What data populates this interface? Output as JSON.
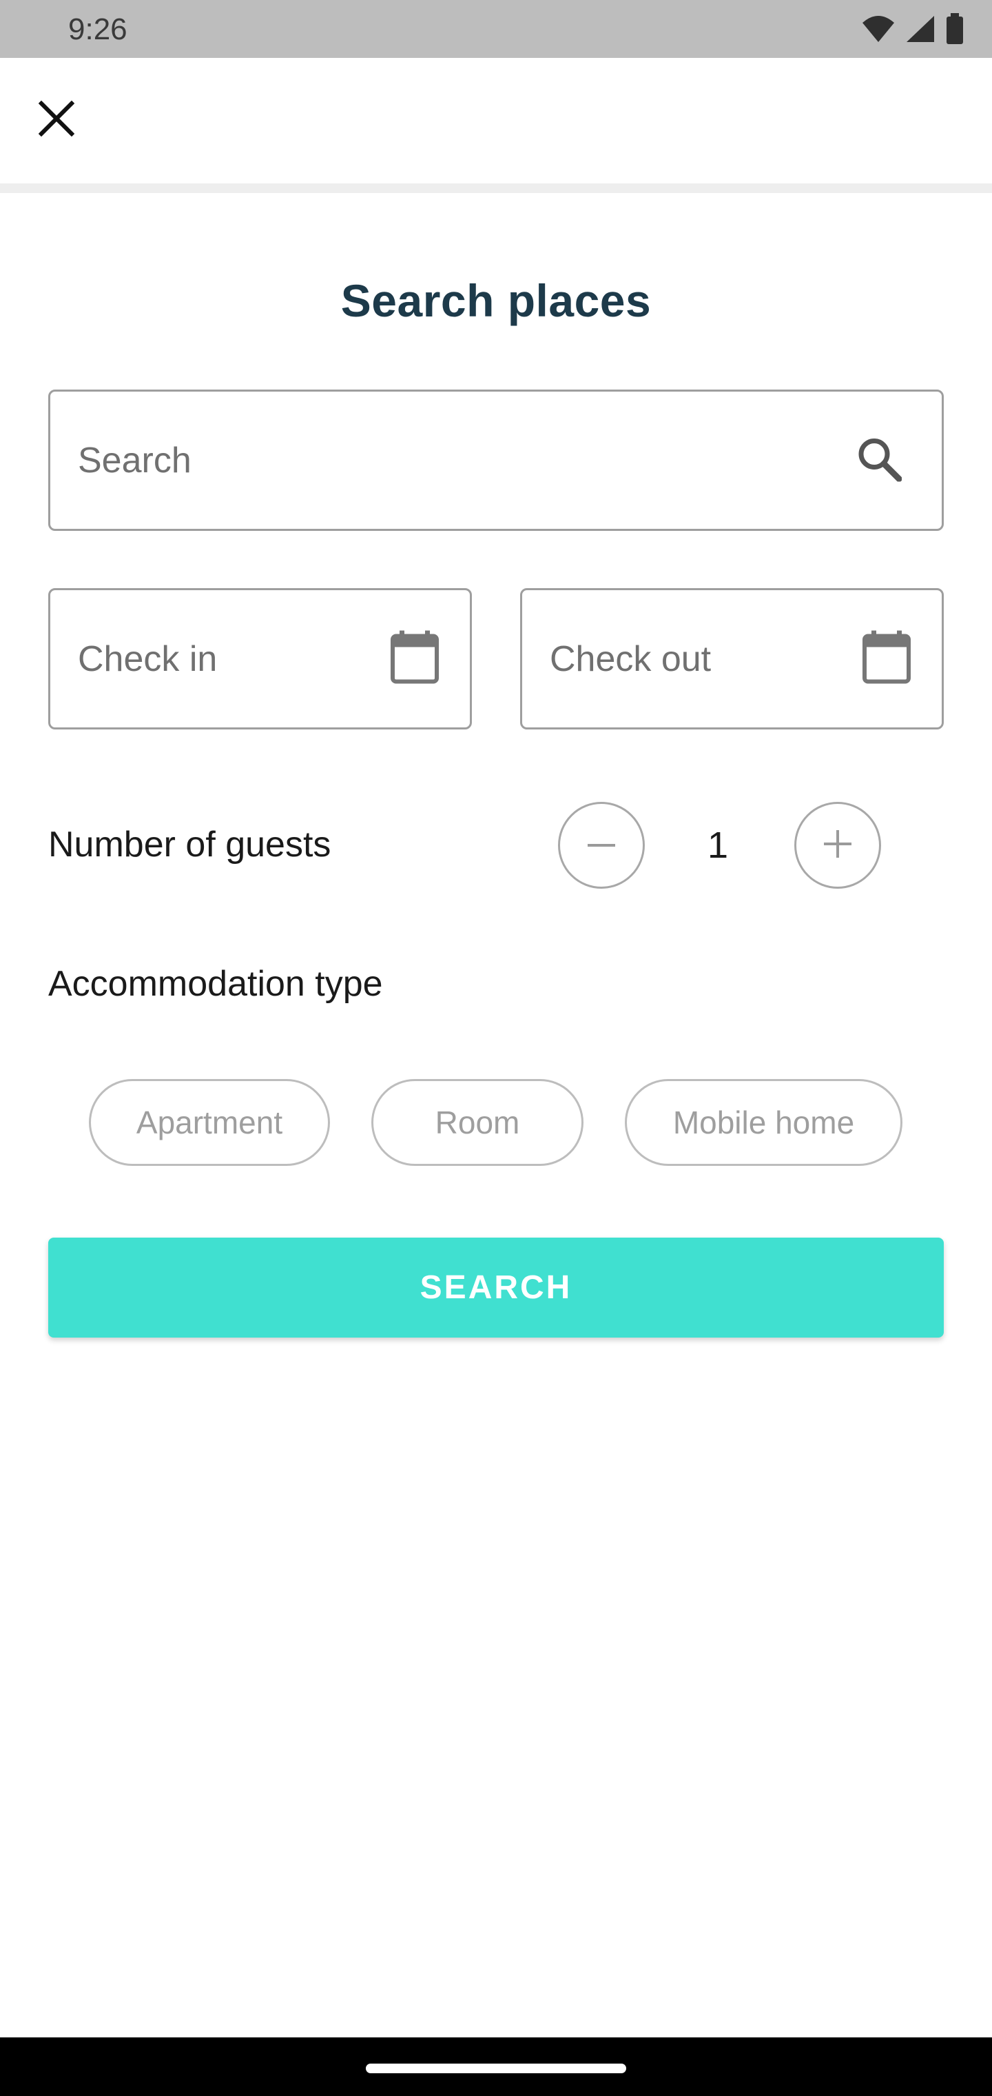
{
  "status_bar": {
    "time": "9:26",
    "icons": [
      "wifi-icon",
      "cellular-signal-icon",
      "battery-icon"
    ]
  },
  "app_bar": {
    "close_icon": "close-icon"
  },
  "page": {
    "title": "Search places"
  },
  "search": {
    "placeholder": "Search",
    "icon": "search-icon"
  },
  "dates": {
    "check_in_placeholder": "Check in",
    "check_out_placeholder": "Check out",
    "icon": "calendar-icon"
  },
  "guests": {
    "label": "Number of guests",
    "count": "1",
    "decrement_icon": "minus-icon",
    "increment_icon": "plus-icon"
  },
  "accommodation": {
    "label": "Accommodation type",
    "options": [
      "Apartment",
      "Room",
      "Mobile home"
    ]
  },
  "actions": {
    "search_label": "SEARCH"
  },
  "colors": {
    "accent": "#40e0d0",
    "title": "#1d3a4a",
    "status_bar": "#bdbdbd",
    "border": "#9e9e9e"
  }
}
